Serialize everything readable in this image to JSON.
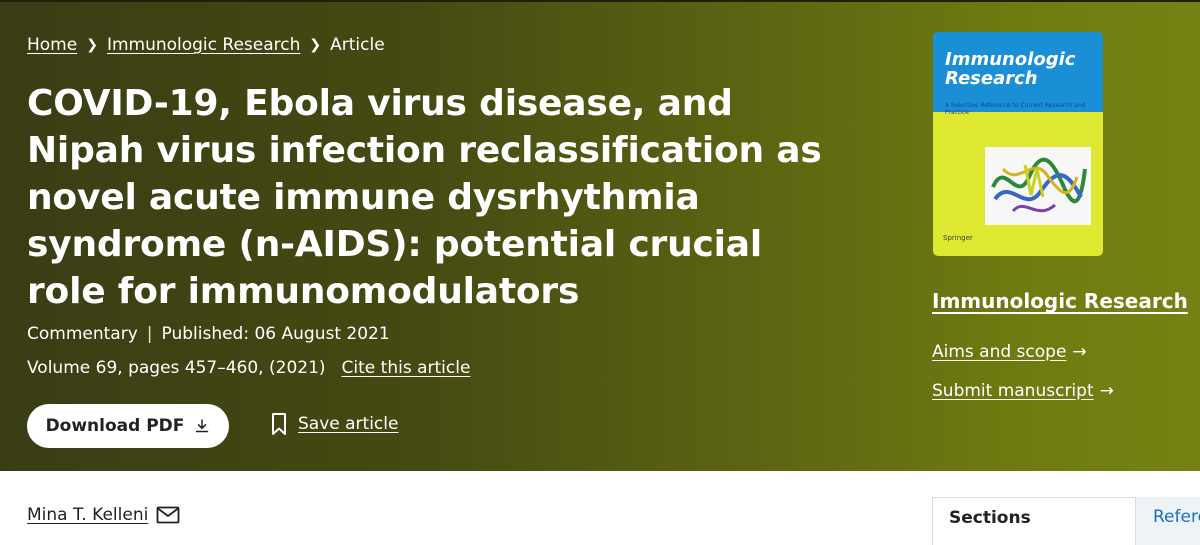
{
  "breadcrumb": {
    "home": "Home",
    "journal": "Immunologic Research",
    "current": "Article"
  },
  "article": {
    "title": "COVID-19, Ebola virus disease, and Nipah virus infection reclassification as novel acute immune dysrhythmia syndrome (n-AIDS): potential crucial role for immunomodulators",
    "type": "Commentary",
    "separator": "|",
    "published": "Published: 06 August 2021",
    "volume_info": "Volume 69, pages 457–460, (2021)",
    "cite_label": "Cite this article"
  },
  "actions": {
    "download_label": "Download PDF",
    "save_label": "Save article"
  },
  "cover": {
    "title_line1": "Immunologic",
    "title_line2": "Research",
    "subtitle": "A Selective Reference to Current Research and Practice",
    "publisher": "Springer"
  },
  "sidebar": {
    "journal_title": "Immunologic Research",
    "aims_label": "Aims and scope",
    "submit_label": "Submit manuscript",
    "arrow": "→"
  },
  "author": {
    "name": "Mina T. Kelleni"
  },
  "tabs": {
    "sections": "Sections",
    "references": "References"
  },
  "colors": {
    "hero_dark": "#3a3d14",
    "hero_light": "#758213",
    "cover_blue": "#1b8fd6",
    "cover_yellow": "#dfe830",
    "link_blue": "#1a6ec2"
  }
}
